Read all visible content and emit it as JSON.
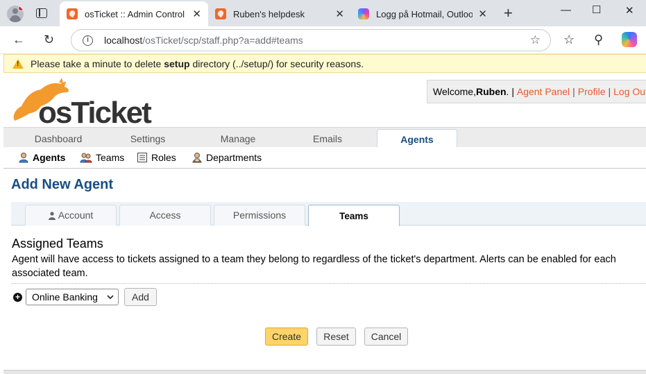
{
  "browser": {
    "tabs": [
      {
        "title": "osTicket :: Admin Control Pa",
        "active": true
      },
      {
        "title": "Ruben's helpdesk",
        "active": false
      },
      {
        "title": "Logg på Hotmail, Outlook, M",
        "active": false
      }
    ],
    "url_host": "localhost",
    "url_path": "/osTicket/scp/staff.php?a=add#teams",
    "new_tab": "+",
    "close": "✕"
  },
  "banner": {
    "pre": "Please take a minute to delete ",
    "bold": "setup",
    "post": " directory (../setup/) for security reasons."
  },
  "header": {
    "logo_text": "osTicket",
    "welcome_prefix": "Welcome, ",
    "user": "Ruben",
    "after_user": ". |",
    "links": [
      "Agent Panel",
      "Profile",
      "Log Out"
    ]
  },
  "main_nav": {
    "tabs": [
      {
        "label": "Dashboard"
      },
      {
        "label": "Settings"
      },
      {
        "label": "Manage"
      },
      {
        "label": "Emails"
      },
      {
        "label": "Agents",
        "active": true
      }
    ]
  },
  "sub_nav": {
    "items": [
      {
        "label": "Agents",
        "active": true,
        "icon": "agent-icon"
      },
      {
        "label": "Teams",
        "icon": "teams-icon"
      },
      {
        "label": "Roles",
        "icon": "roles-icon"
      },
      {
        "label": "Departments",
        "icon": "departments-icon"
      }
    ]
  },
  "page": {
    "title": "Add New Agent",
    "tabs": [
      {
        "label": "Account",
        "icon": "user-icon"
      },
      {
        "label": "Access"
      },
      {
        "label": "Permissions"
      },
      {
        "label": "Teams",
        "active": true
      }
    ],
    "section_title": "Assigned Teams",
    "section_desc": "Agent will have access to tickets assigned to a team they belong to regardless of the ticket's department. Alerts can be enabled for each associated team.",
    "team_select": "Online Banking",
    "add_label": "Add",
    "create_label": "Create",
    "reset_label": "Reset",
    "cancel_label": "Cancel"
  },
  "colors": {
    "accent": "#184e81",
    "link": "#e65b2a",
    "primary_button": "#fdd46a",
    "warning_bg": "#fefbd1"
  }
}
